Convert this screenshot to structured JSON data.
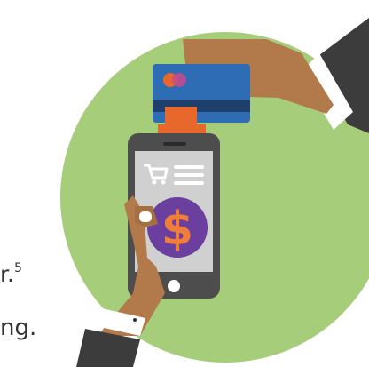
{
  "partial_text": {
    "line_1": "r.",
    "line_1_superscript": "5",
    "line_2": "ng."
  },
  "illustration": {
    "subject": "mobile-card-payment",
    "circle_color": "#a6cd79",
    "phone_color": "#4d4d4d",
    "screen_color": "#d0d0d0",
    "card_color": "#2e6db4",
    "card_stripe_color": "#1d3f6a",
    "reader_color": "#e8672a",
    "coin_color": "#6b3f9e",
    "dollar_color": "#f07d3a",
    "skin_color": "#b27a4a",
    "sleeve_color": "#3c3c3c",
    "cuff_color": "#ffffff"
  }
}
